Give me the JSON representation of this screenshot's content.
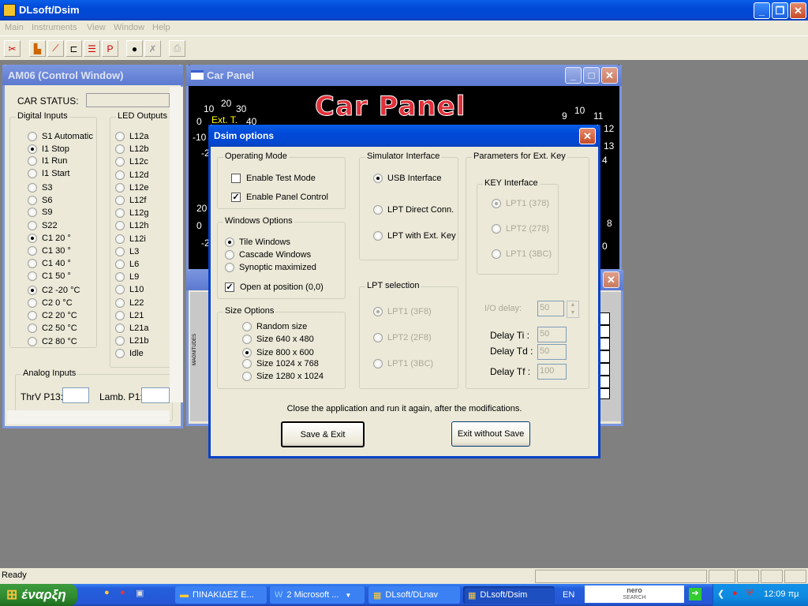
{
  "app": {
    "title": "DLsoft/Dsim"
  },
  "menu": [
    "Main",
    "Instruments",
    "View",
    "Window",
    "Help"
  ],
  "toolbar": {
    "icons": [
      "cut-scissors-icon",
      "bar-graph-icon",
      "line-graph-icon",
      "axes-graph-icon",
      "step-graph-icon",
      "plot-p-icon",
      "gauge-icon",
      "tools-icon",
      "export-icon"
    ]
  },
  "control_window": {
    "title": "AM06 (Control Window)",
    "car_status_label": "CAR STATUS:",
    "car_status_value": "",
    "digital_inputs": {
      "label": "Digital Inputs",
      "items": [
        {
          "label": "S1 Automatic",
          "checked": false
        },
        {
          "label": "I1 Stop",
          "checked": true
        },
        {
          "label": "I1 Run",
          "checked": false
        },
        {
          "label": "I1 Start",
          "checked": false
        },
        {
          "label": "S3",
          "checked": false
        },
        {
          "label": "S6",
          "checked": false
        },
        {
          "label": "S9",
          "checked": false
        },
        {
          "label": "S22",
          "checked": false
        },
        {
          "label": "C1  20 °",
          "checked": true
        },
        {
          "label": "C1  30 °",
          "checked": false
        },
        {
          "label": "C1  40 °",
          "checked": false
        },
        {
          "label": "C1  50 °",
          "checked": false
        },
        {
          "label": "C2 -20 °C",
          "checked": true
        },
        {
          "label": "C2    0 °C",
          "checked": false
        },
        {
          "label": "C2  20 °C",
          "checked": false
        },
        {
          "label": "C2  50 °C",
          "checked": false
        },
        {
          "label": "C2  80 °C",
          "checked": false
        }
      ]
    },
    "led_outputs": {
      "label": "LED Outputs",
      "items": [
        "L12a",
        "L12b",
        "L12c",
        "L12d",
        "L12e",
        "L12f",
        "L12g",
        "L12h",
        "L12i",
        "L3",
        "L6",
        "L9",
        "L10",
        "L22",
        "L21",
        "L21a",
        "L21b",
        "Idle"
      ]
    },
    "analog_inputs": {
      "label": "Analog Inputs",
      "thrv_label": "ThrV P13:",
      "thrv_value": "",
      "lamb_label": "Lamb. P1:",
      "lamb_value": ""
    }
  },
  "car_panel": {
    "title": "Car Panel",
    "banner": "Car Panel",
    "left_gauge_ticks": [
      "10",
      "20",
      "30",
      "0",
      "40",
      "-10",
      "-2",
      "20",
      "0",
      "-2"
    ],
    "left_gauge_label": "Ext. T.",
    "right_gauge_ticks": [
      "9",
      "10",
      "11",
      "12",
      "13",
      "4",
      "8",
      "0"
    ]
  },
  "background_window": {
    "axis_label": "MAGNITUDES"
  },
  "dialog": {
    "title": "Dsim options",
    "operating_mode": {
      "label": "Operating Mode",
      "items": [
        {
          "label": "Enable Test Mode",
          "checked": false
        },
        {
          "label": "Enable Panel Control",
          "checked": true
        }
      ]
    },
    "windows_options": {
      "label": "Windows Options",
      "items": [
        {
          "label": "Tile Windows",
          "checked": true
        },
        {
          "label": "Cascade Windows",
          "checked": false
        },
        {
          "label": "Synoptic maximized",
          "checked": false
        }
      ],
      "open_at_origin": {
        "label": "Open at position (0,0)",
        "checked": true
      }
    },
    "size_options": {
      "label": "Size Options",
      "items": [
        {
          "label": "Random size",
          "checked": false
        },
        {
          "label": "Size 640 x 480",
          "checked": false
        },
        {
          "label": "Size 800 x 600",
          "checked": true
        },
        {
          "label": "Size 1024 x 768",
          "checked": false
        },
        {
          "label": "Size 1280 x 1024",
          "checked": false
        }
      ]
    },
    "simulator_interface": {
      "label": "Simulator Interface",
      "items": [
        {
          "label": "USB Interface",
          "checked": true
        },
        {
          "label": "LPT Direct Conn.",
          "checked": false
        },
        {
          "label": "LPT with Ext. Key",
          "checked": false
        }
      ]
    },
    "lpt_selection": {
      "label": "LPT selection",
      "items": [
        {
          "label": "LPT1 (3F8)",
          "checked": true
        },
        {
          "label": "LPT2 (2F8)",
          "checked": false
        },
        {
          "label": "LPT1 (3BC)",
          "checked": false
        }
      ]
    },
    "ext_key": {
      "label": "Parameters for Ext. Key",
      "key_interface": {
        "label": "KEY Interface",
        "items": [
          {
            "label": "LPT1 (378)",
            "checked": true
          },
          {
            "label": "LPT2 (278)",
            "checked": false
          },
          {
            "label": "LPT1 (3BC)",
            "checked": false
          }
        ]
      },
      "io_delay": {
        "label": "I/O delay:",
        "value": "50"
      },
      "delay_ti": {
        "label": "Delay Ti :",
        "value": "50"
      },
      "delay_td": {
        "label": "Delay Td :",
        "value": "50"
      },
      "delay_tf": {
        "label": "Delay Tf :",
        "value": "100"
      }
    },
    "note": "Close the application and run it again, after the modifications.",
    "save_exit": "Save & Exit",
    "exit_no_save": "Exit without Save"
  },
  "status_bar": {
    "text": "Ready"
  },
  "taskbar": {
    "start": "έναρξη",
    "items": [
      "ΠΙΝΑΚΙΔΕΣ Ε...",
      "2 Microsoft ...",
      "DLsoft/DLnav",
      "DLsoft/Dsim"
    ],
    "language": "EN",
    "nero_top": "nero",
    "nero_bottom": "SEARCH",
    "clock": "12:09 πμ"
  }
}
